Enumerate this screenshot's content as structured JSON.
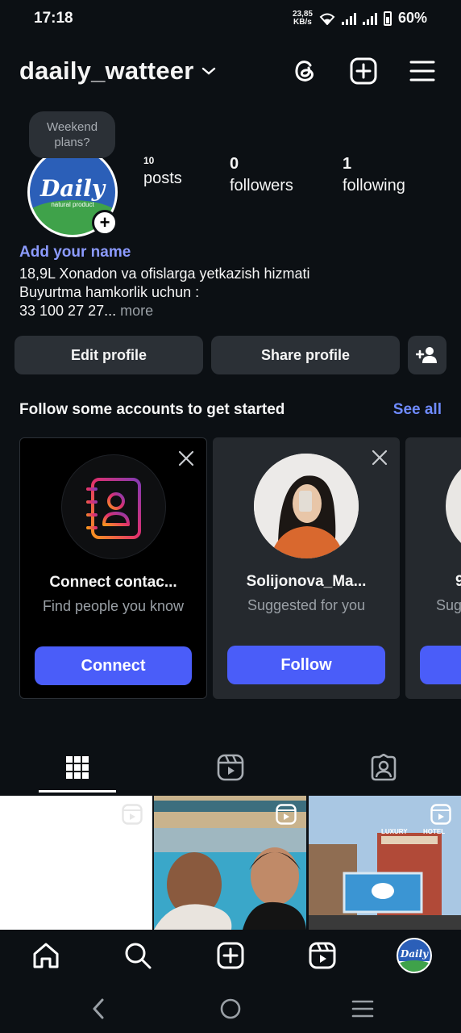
{
  "status_bar": {
    "time": "17:18",
    "net_speed_top": "23,85",
    "net_speed_bottom": "KB/s",
    "battery": "60%"
  },
  "header": {
    "username": "daaily_watteer",
    "icons": [
      "threads-icon",
      "create-icon",
      "menu-icon"
    ]
  },
  "profile": {
    "note": "Weekend plans?",
    "avatar_logo": "Daily",
    "avatar_sub": "natural product",
    "stats": [
      {
        "value": "10",
        "label": "posts"
      },
      {
        "value": "0",
        "label": "followers"
      },
      {
        "value": "1",
        "label": "following"
      }
    ],
    "add_name": "Add your name",
    "bio_lines": [
      "18,9L Xonadon va ofislarga yetkazish hizmati",
      "Buyurtma hamkorlik uchun :",
      "33 100 27 27..."
    ],
    "more": " more"
  },
  "actions": {
    "edit_profile": "Edit profile",
    "share_profile": "Share profile"
  },
  "suggestions": {
    "title": "Follow some accounts to get started",
    "see_all": "See all",
    "cards": [
      {
        "title": "Connect contac...",
        "subtitle": "Find people you know",
        "button": "Connect"
      },
      {
        "title": "Solijonova_Ma...",
        "subtitle": "Suggested for you",
        "button": "Follow"
      },
      {
        "title": "9",
        "subtitle": "Sug",
        "button": ""
      }
    ]
  },
  "grid_posts": [
    {
      "type": "reel",
      "thumb": "blank-white"
    },
    {
      "type": "reel",
      "thumb": "two-men"
    },
    {
      "type": "reel",
      "thumb": "hotel-billboard",
      "signs": [
        "LUXURY",
        "HOTEL"
      ]
    }
  ],
  "colors": {
    "background": "#0c1014",
    "button": "#2b3036",
    "accent": "#4a5df9",
    "link": "#6f8bff"
  }
}
